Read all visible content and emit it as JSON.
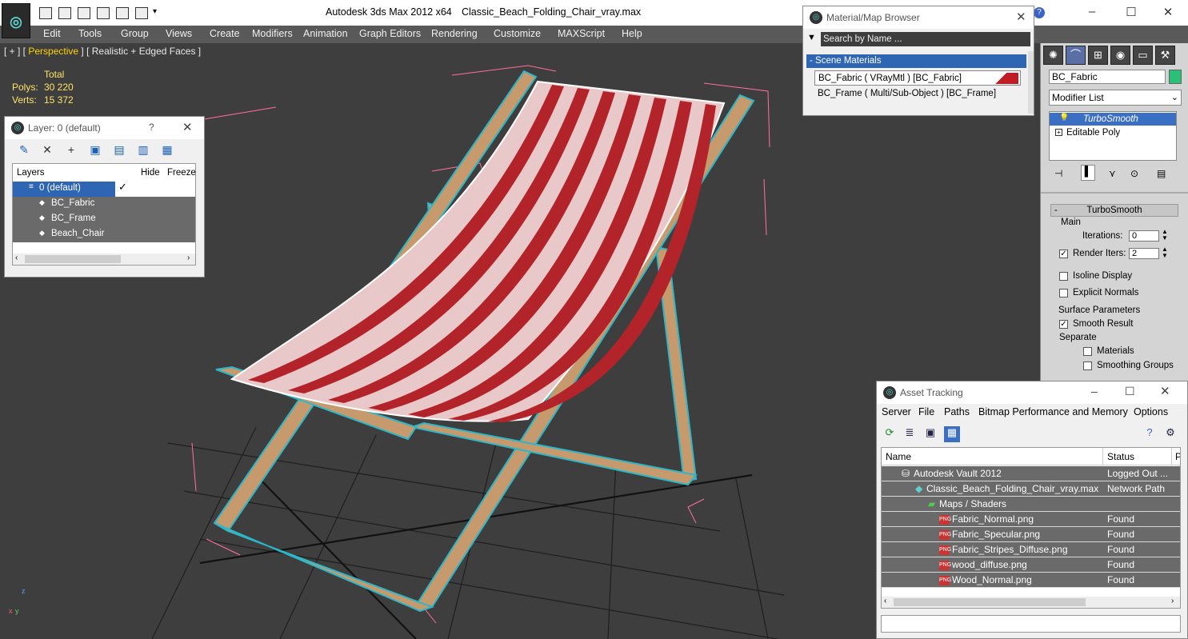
{
  "window": {
    "title": "Autodesk 3ds Max  2012 x64",
    "file": "Classic_Beach_Folding_Chair_vray.max"
  },
  "menu": [
    "Edit",
    "Tools",
    "Group",
    "Views",
    "Create",
    "Modifiers",
    "Animation",
    "Graph Editors",
    "Rendering",
    "Customize",
    "MAXScript",
    "Help"
  ],
  "viewport": {
    "label_prefix": "[ + ] [ ",
    "label_view": "Perspective",
    "label_suffix": " ] [ Realistic + Edged Faces ]",
    "stats": {
      "total_label": "Total",
      "polys_label": "Polys:",
      "polys": "30 220",
      "verts_label": "Verts:",
      "verts": "15 372"
    },
    "gizmo": {
      "x": "x",
      "z": "z",
      "y": "y"
    }
  },
  "layer_dialog": {
    "title": "Layer: 0 (default)",
    "help": "?",
    "columns": [
      "Layers",
      "Hide",
      "Freeze"
    ],
    "rows": [
      {
        "name": "0 (default)",
        "active": true
      },
      {
        "name": "BC_Fabric"
      },
      {
        "name": "BC_Frame"
      },
      {
        "name": "Beach_Chair"
      }
    ]
  },
  "material_browser": {
    "title": "Material/Map Browser",
    "search_placeholder": "Search by Name ...",
    "group": "- Scene Materials",
    "materials": [
      "BC_Fabric  ( VRayMtl )  [BC_Fabric]",
      "BC_Frame  ( Multi/Sub-Object )  [BC_Frame]"
    ]
  },
  "command_panel": {
    "object_name": "BC_Fabric",
    "modifier_list": "Modifier List",
    "stack": [
      "TurboSmooth",
      "Editable Poly"
    ],
    "rollout_title": "TurboSmooth",
    "main_label": "Main",
    "iterations_label": "Iterations:",
    "iterations": "0",
    "render_iters_label": "Render Iters:",
    "render_iters": "2",
    "isoline": "Isoline Display",
    "explicit_normals": "Explicit Normals",
    "surface_params": "Surface Parameters",
    "smooth_result": "Smooth Result",
    "separate": "Separate",
    "materials": "Materials",
    "smoothing_groups": "Smoothing Groups"
  },
  "asset_tracking": {
    "title": "Asset Tracking",
    "menu": [
      "Server",
      "File",
      "Paths",
      "Bitmap Performance and Memory",
      "Options"
    ],
    "columns": [
      "Name",
      "Status",
      "P"
    ],
    "rows": [
      {
        "name": "Autodesk Vault 2012",
        "status": "Logged Out ..."
      },
      {
        "name": "Classic_Beach_Folding_Chair_vray.max",
        "status": "Network Path"
      },
      {
        "name": "Maps / Shaders",
        "status": ""
      },
      {
        "name": "Fabric_Normal.png",
        "status": "Found"
      },
      {
        "name": "Fabric_Specular.png",
        "status": "Found"
      },
      {
        "name": "Fabric_Stripes_Diffuse.png",
        "status": "Found"
      },
      {
        "name": "wood_diffuse.png",
        "status": "Found"
      },
      {
        "name": "Wood_Normal.png",
        "status": "Found"
      }
    ]
  },
  "colors": {
    "viewport_bg": "#3e3e3e",
    "stripe_red": "#b3242a",
    "stripe_light": "#e8c8c8",
    "wood": "#c69a6c",
    "frame_edge": "#2bb7c9",
    "bbox": "#ff6f9a",
    "stats_yellow": "#ffe36a"
  }
}
